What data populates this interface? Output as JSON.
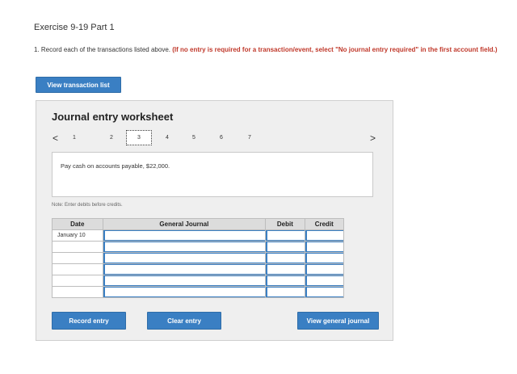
{
  "header": {
    "exercise_title": "Exercise 9-19 Part 1",
    "instruction_prefix": "1. Record each of the transactions listed above.",
    "instruction_highlight": "(If no entry is required for a transaction/event, select \"No journal entry required\" in the first account field.)"
  },
  "buttons": {
    "view_transaction_list": "View transaction list",
    "record_entry": "Record entry",
    "clear_entry": "Clear entry",
    "view_general_journal": "View general journal"
  },
  "worksheet": {
    "title": "Journal entry worksheet",
    "prev_arrow": "<",
    "next_arrow": ">",
    "steps": [
      "1",
      "2",
      "3",
      "4",
      "5",
      "6",
      "7"
    ],
    "active_step": "3",
    "transaction_text": "Pay cash on accounts payable, $22,000.",
    "note": "Note: Enter debits before credits."
  },
  "journal": {
    "headers": [
      "Date",
      "General Journal",
      "Debit",
      "Credit"
    ],
    "rows": [
      {
        "date": "January 10",
        "account": "",
        "debit": "",
        "credit": ""
      },
      {
        "date": "",
        "account": "",
        "debit": "",
        "credit": ""
      },
      {
        "date": "",
        "account": "",
        "debit": "",
        "credit": ""
      },
      {
        "date": "",
        "account": "",
        "debit": "",
        "credit": ""
      },
      {
        "date": "",
        "account": "",
        "debit": "",
        "credit": ""
      },
      {
        "date": "",
        "account": "",
        "debit": "",
        "credit": ""
      }
    ]
  },
  "colors": {
    "button_blue": "#3a7fc3",
    "highlight_red": "#c0392b",
    "panel_bg": "#efefef"
  }
}
